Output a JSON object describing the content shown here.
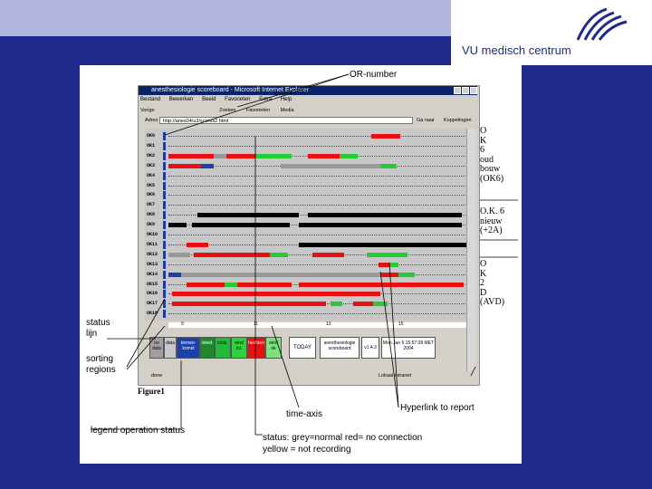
{
  "logo": {
    "text": "VU medisch centrum"
  },
  "window": {
    "title": "anesthesiologie scoreboard - Microsoft Internet Explorer",
    "menu": [
      "Bestand",
      "Bewerken",
      "Beeld",
      "Favorieten",
      "Extra",
      "Help"
    ],
    "toolbar": [
      "Vorige",
      "Zoeken",
      "Favorieten",
      "Media"
    ],
    "address_label": "Adres",
    "address_value": "http://anes04/u3/scores2.html",
    "go_label": "Ga naar",
    "links_label": "Koppelingen",
    "status_left": "done",
    "status_right": "Lokaal intranet"
  },
  "rows": [
    "OK0",
    "OK1",
    "OK2",
    "OK3",
    "OK4",
    "OK5",
    "OK6",
    "OK7",
    "OK8",
    "OK9",
    "OK10",
    "OK11",
    "OK12",
    "OK13",
    "OK14",
    "OK15",
    "OK16",
    "OK17",
    "OK18"
  ],
  "axis_ticks": [
    "9",
    "11",
    "13",
    "15"
  ],
  "legend": [
    {
      "label": "no data",
      "color": "#a0a0a0"
    },
    {
      "label": "data",
      "color": "#c8c8c8"
    },
    {
      "label": "binnen-komst",
      "color": "#1e3ea8"
    },
    {
      "label": "inleid.",
      "color": "#1a8a2a"
    },
    {
      "label": "incis.",
      "color": "#22b83a"
    },
    {
      "label": "eind inl.",
      "color": "#30d040"
    },
    {
      "label": "hechten",
      "color": "#e81010"
    },
    {
      "label": "eind ok",
      "color": "#7ee07e"
    },
    {
      "label": "TODAY",
      "color": "#ffffff"
    },
    {
      "label": "anesthesiologie scoreboard",
      "color": "#ffffff"
    },
    {
      "label": "v1.4.3",
      "color": "#ffffff"
    },
    {
      "label": "Mon Jan 5 15:57:08 MET 2004",
      "color": "#ffffff"
    }
  ],
  "annotations": {
    "or_number": "OR-number",
    "status_line": "status lijn",
    "sorting_regions": "sorting regions",
    "figure": "Figure1",
    "time_axis": "time-axis",
    "hyperlink": "Hyperlink to report",
    "legend_status": "legend operation status",
    "status_matrix": "status: grey=normal red= no connection",
    "status_yellow": "yellow = not recording",
    "group1": [
      "O",
      "K",
      "6",
      "oud",
      "bouw",
      "(OK6)"
    ],
    "group2": [
      "O.K. 6",
      "nieuw",
      "(+2A)"
    ],
    "group3": [
      "O",
      "K",
      "2",
      "D",
      "(AVD)"
    ]
  }
}
